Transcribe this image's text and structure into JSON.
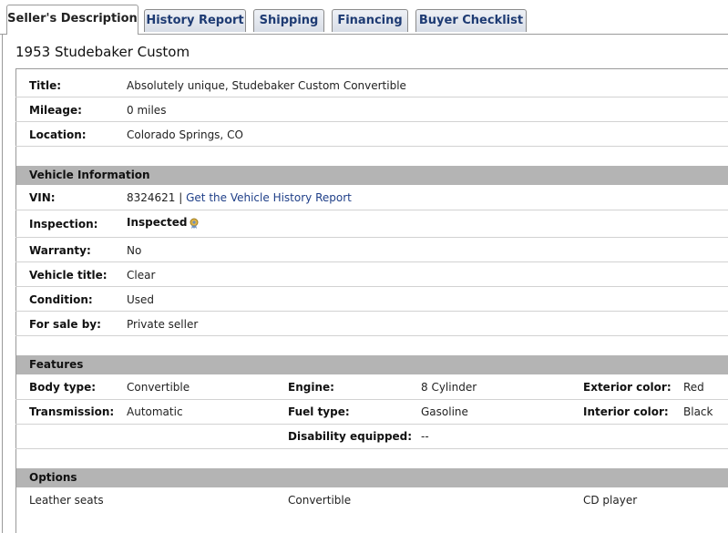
{
  "tabs": [
    {
      "label": "Seller's Description",
      "active": true
    },
    {
      "label": "History Report"
    },
    {
      "label": "Shipping"
    },
    {
      "label": "Financing"
    },
    {
      "label": "Buyer Checklist"
    }
  ],
  "listing_title": "1953 Studebaker Custom",
  "overview": [
    {
      "label": "Title:",
      "value": "Absolutely unique, Studebaker Custom Convertible"
    },
    {
      "label": "Mileage:",
      "value": "0 miles"
    },
    {
      "label": "Location:",
      "value": "Colorado Springs, CO"
    }
  ],
  "vehicle_info": {
    "heading": "Vehicle Information",
    "vin_label": "VIN:",
    "vin_value": "8324621",
    "vin_separator": " | ",
    "vin_link": "Get the Vehicle History Report",
    "inspection_label": "Inspection:",
    "inspection_value": "Inspected",
    "inspection_icon": "inspected-ribbon-icon",
    "rows": [
      {
        "label": "Warranty:",
        "value": "No"
      },
      {
        "label": "Vehicle title:",
        "value": "Clear"
      },
      {
        "label": "Condition:",
        "value": "Used"
      },
      {
        "label": "For sale by:",
        "value": "Private seller"
      }
    ]
  },
  "features": {
    "heading": "Features",
    "body_type_label": "Body type:",
    "body_type": "Convertible",
    "engine_label": "Engine:",
    "engine": "8 Cylinder",
    "exterior_label": "Exterior color:",
    "exterior": "Red",
    "transmission_label": "Transmission:",
    "transmission": "Automatic",
    "fuel_label": "Fuel type:",
    "fuel": "Gasoline",
    "interior_label": "Interior color:",
    "interior": "Black",
    "disability_label": "Disability equipped:",
    "disability": "--"
  },
  "options": {
    "heading": "Options",
    "items": [
      "Leather seats",
      "Convertible",
      "CD player"
    ]
  },
  "colors": {
    "section_bg": "#b4b4b4",
    "link": "#1f3f88",
    "tab_text": "#1e3b73"
  }
}
